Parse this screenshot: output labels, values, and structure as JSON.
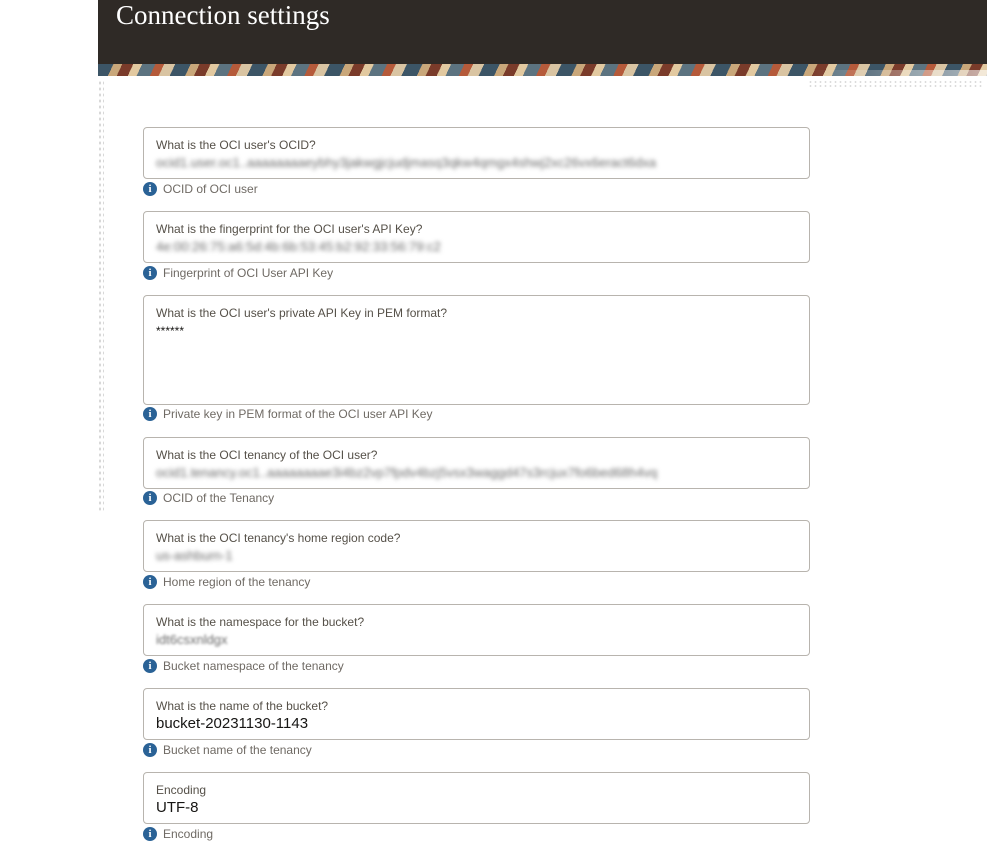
{
  "header": {
    "title": "Connection settings"
  },
  "fields": [
    {
      "label": "What is the OCI user's OCID?",
      "value": "ocid1.user.oc1..aaaaaaaaeybhy3jakwgjcjudjmasq3qkw4qmgx4shwj2xc26vx6eract6dxa",
      "help": "OCID of OCI user",
      "blurred": true
    },
    {
      "label": "What is the fingerprint for the OCI user's API Key?",
      "value": "4e:00:26:75:a6:5d:4b:6b:53:45:b2:92:33:56:79:c2",
      "help": "Fingerprint of OCI User API Key",
      "blurred": true
    },
    {
      "label": "What is the OCI user's private API Key in PEM format?",
      "value": "******",
      "help": "Private key in PEM format of the OCI user API Key",
      "blurred": false
    },
    {
      "label": "What is the OCI tenancy of the OCI user?",
      "value": "ocid1.tenancy.oc1..aaaaaaaae3i4bz2vp7fpdv4bzj5vsx3waggd47s3rcjux7fo6bed68h4vq",
      "help": "OCID of the Tenancy",
      "blurred": true
    },
    {
      "label": "What is the OCI tenancy's home region code?",
      "value": "us-ashburn-1",
      "help": "Home region of the tenancy",
      "blurred": true
    },
    {
      "label": "What is the namespace for the bucket?",
      "value": "idt6csxnldgx",
      "help": "Bucket namespace of the tenancy",
      "blurred": true
    },
    {
      "label": "What is the name of the bucket?",
      "value": "bucket-20231130-1143",
      "help": "Bucket name of the tenancy",
      "blurred": false
    },
    {
      "label": "Encoding",
      "value": "UTF-8",
      "help": "Encoding",
      "blurred": false
    }
  ],
  "icons": {
    "help": "info-icon"
  },
  "colors": {
    "header_bg": "#2f2a26",
    "info_icon": "#2a6296",
    "field_border": "#b8b4ae"
  }
}
